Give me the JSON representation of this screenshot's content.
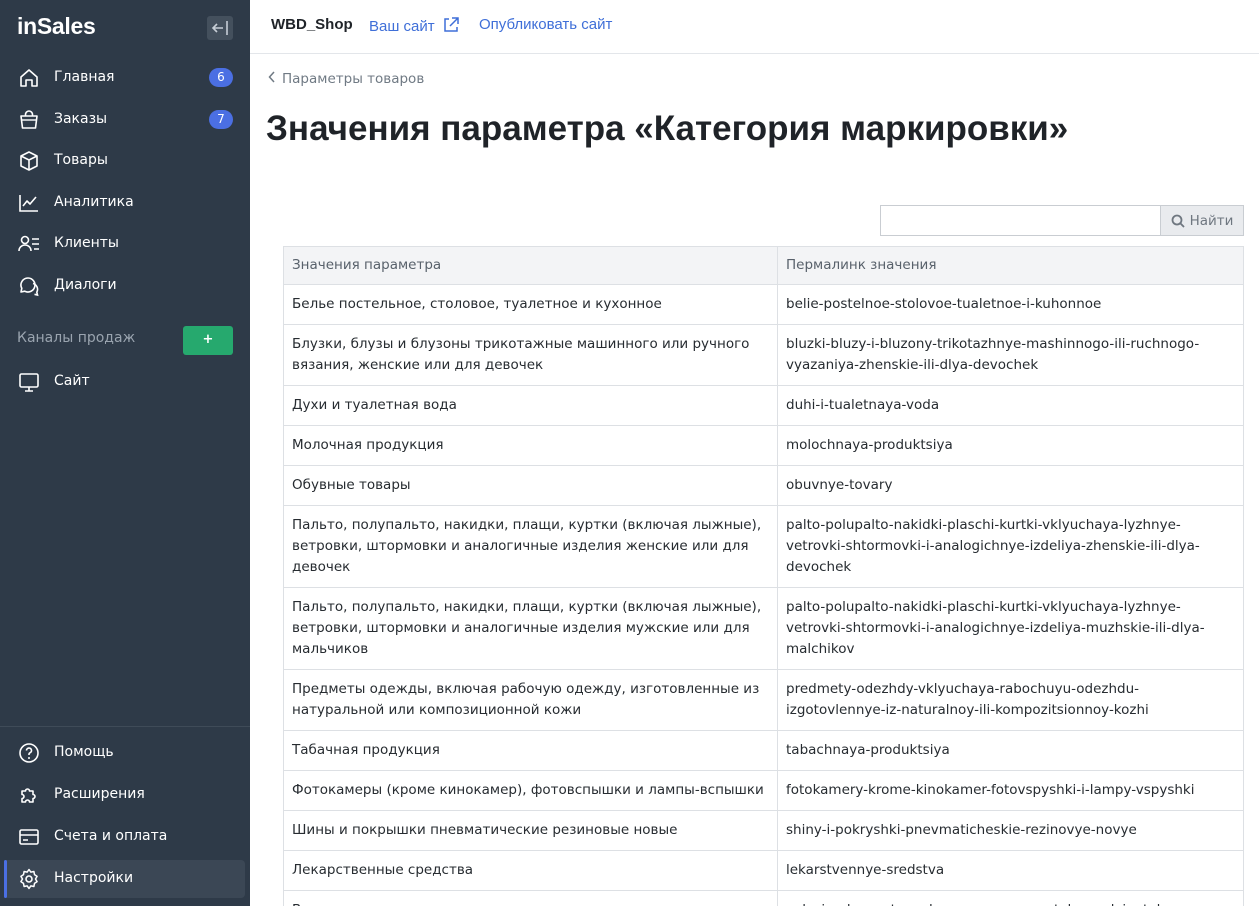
{
  "sidebar": {
    "logo": "inSales",
    "nav": [
      {
        "label": "Главная",
        "icon": "home-icon",
        "badge": "6"
      },
      {
        "label": "Заказы",
        "icon": "shopping-bag-icon",
        "badge": "7"
      },
      {
        "label": "Товары",
        "icon": "box-icon"
      },
      {
        "label": "Аналитика",
        "icon": "chart-line-icon"
      },
      {
        "label": "Клиенты",
        "icon": "users-list-icon"
      },
      {
        "label": "Диалоги",
        "icon": "chat-icon"
      }
    ],
    "channels_label": "Каналы продаж",
    "channels_add": "+",
    "channel_site": "Сайт",
    "bottom": [
      {
        "label": "Помощь",
        "icon": "help-icon"
      },
      {
        "label": "Расширения",
        "icon": "puzzle-icon"
      },
      {
        "label": "Счета и оплата",
        "icon": "card-icon"
      },
      {
        "label": "Настройки",
        "icon": "gear-icon"
      }
    ]
  },
  "topbar": {
    "shop_name": "WBD_Shop",
    "site_link": "Ваш сайт",
    "publish_link": "Опубликовать сайт"
  },
  "breadcrumb": "Параметры товаров",
  "page_title": "Значения параметра «Категория маркировки»",
  "search": {
    "placeholder": "",
    "button": "Найти"
  },
  "table": {
    "headers": [
      "Значения параметра",
      "Пермалинк значения"
    ],
    "rows": [
      [
        "Белье постельное, столовое, туалетное и кухонное",
        "belie-postelnoe-stolovoe-tualetnoe-i-kuhonnoe"
      ],
      [
        "Блузки, блузы и блузоны трикотажные машинного или ручного вязания, женские или для девочек",
        "bluzki-bluzy-i-bluzony-trikotazhnye-mashinnogo-ili-ruchnogo-vyazaniya-zhenskie-ili-dlya-devochek"
      ],
      [
        "Духи и туалетная вода",
        "duhi-i-tualetnaya-voda"
      ],
      [
        "Молочная продукция",
        "molochnaya-produktsiya"
      ],
      [
        "Обувные товары",
        "obuvnye-tovary"
      ],
      [
        "Пальто, полупальто, накидки, плащи, куртки (включая лыжные), ветровки, штормовки и аналогичные изделия женские или для девочек",
        "palto-polupalto-nakidki-plaschi-kurtki-vklyuchaya-lyzhnye-vetrovki-shtormovki-i-analogichnye-izdeliya-zhenskie-ili-dlya-devochek"
      ],
      [
        "Пальто, полупальто, накидки, плащи, куртки (включая лыжные), ветровки, штормовки и аналогичные изделия мужские или для мальчиков",
        "palto-polupalto-nakidki-plaschi-kurtki-vklyuchaya-lyzhnye-vetrovki-shtormovki-i-analogichnye-izdeliya-muzhskie-ili-dlya-malchikov"
      ],
      [
        "Предметы одежды, включая рабочую одежду, изготовленные из натуральной или композиционной кожи",
        "predmety-odezhdy-vklyuchaya-rabochuyu-odezhdu-izgotovlennye-iz-naturalnoy-ili-kompozitsionnoy-kozhi"
      ],
      [
        "Табачная продукция",
        "tabachnaya-produktsiya"
      ],
      [
        "Фотокамеры (кроме кинокамер), фотовспышки и лампы-вспышки",
        "fotokamery-krome-kinokamer-fotovspyshki-i-lampy-vspyshki"
      ],
      [
        "Шины и покрышки пневматические резиновые новые",
        "shiny-i-pokryshki-pnevmaticheskie-rezinovye-novye"
      ],
      [
        "Лекарственные средства",
        "lekarstvennye-sredstva"
      ],
      [
        "Велосипеды с установленным вспомогательным двигателем, с",
        "velosipedy-s-ustanovlennym-vspomogatelnym-dvigatelem-s-"
      ]
    ]
  }
}
